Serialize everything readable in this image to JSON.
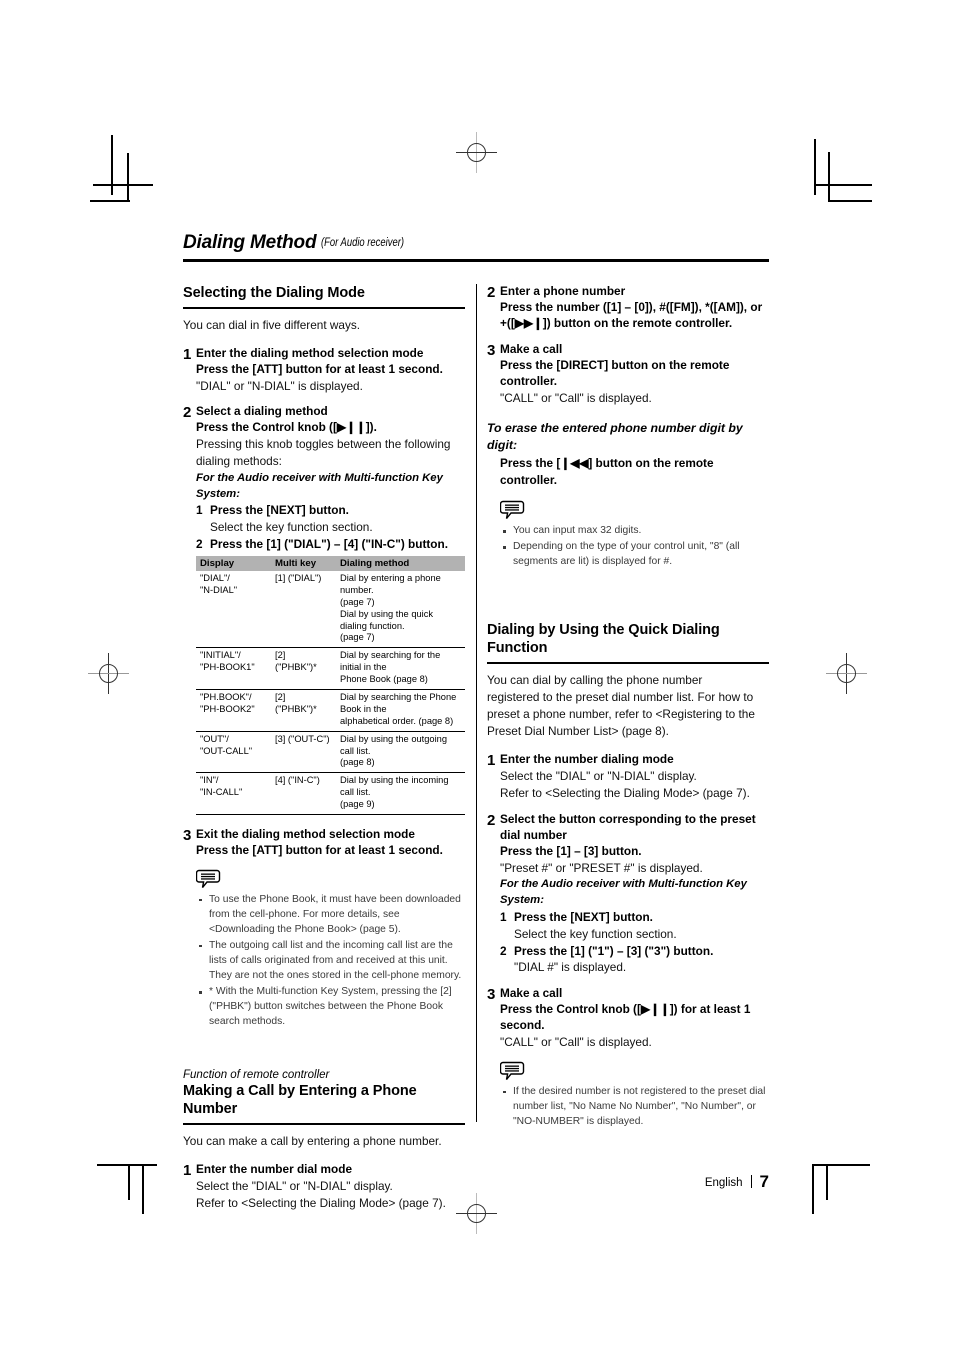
{
  "chapter": {
    "title": "Dialing Method",
    "subtitle": "(For Audio receiver)"
  },
  "left": {
    "section1": {
      "heading": "Selecting the Dialing Mode",
      "lead": "You can dial in five different ways.",
      "steps": [
        {
          "num": "1",
          "title": "Enter the dialing method selection mode",
          "bold": "Press the [ATT] button for at least 1 second.",
          "plain": "\"DIAL\" or \"N-DIAL\" is displayed."
        },
        {
          "num": "2",
          "title": "Select a dialing method",
          "bold": "Press the Control knob ([▶❙❙]).",
          "plain_1": "Pressing this knob toggles between the following",
          "plain_2": "dialing methods:",
          "italbold": "For the Audio receiver with Multi-function Key System:",
          "sub1_num": "1",
          "sub1_bold": "Press the [NEXT] button.",
          "sub1_plain": "Select the key function section.",
          "sub2_num": "2",
          "sub2_bold": "Press the [1] (\"DIAL\") – [4] (\"IN-C\") button."
        },
        {
          "num": "3",
          "title": "Exit the dialing method selection mode",
          "bold": "Press the [ATT] button for at least 1 second."
        }
      ],
      "table": {
        "headers": [
          "Display",
          "Multi key",
          "Dialing method"
        ],
        "rows": [
          {
            "display": [
              "\"DIAL\"/",
              "\"N-DIAL\""
            ],
            "multikey": [
              "[1] (\"DIAL\")"
            ],
            "method": [
              "Dial by entering a phone number.",
              "(page 7)",
              "Dial by using the quick dialing function.",
              "(page 7)"
            ]
          },
          {
            "display": [
              "\"INITIAL\"/",
              "\"PH-BOOK1\""
            ],
            "multikey": [
              "[2]",
              "(\"PHBK\")*"
            ],
            "method": [
              "Dial by searching for the initial in the",
              "Phone Book (page 8)"
            ]
          },
          {
            "display": [
              "\"PH.BOOK\"/",
              "\"PH-BOOK2\""
            ],
            "multikey": [
              "[2]",
              "(\"PHBK\")*"
            ],
            "method": [
              "Dial by searching the Phone Book in the",
              "alphabetical order. (page 8)"
            ]
          },
          {
            "display": [
              "\"OUT\"/",
              "\"OUT-CALL\""
            ],
            "multikey": [
              "[3] (\"OUT-C\")"
            ],
            "method": [
              "Dial by using the outgoing call list.",
              "(page 8)"
            ]
          },
          {
            "display": [
              "\"IN\"/",
              "\"IN-CALL\""
            ],
            "multikey": [
              "[4] (\"IN-C\")"
            ],
            "method": [
              "Dial by using the incoming call list.",
              "(page 9)"
            ]
          }
        ]
      },
      "notes": [
        {
          "text": "To use the Phone Book, it must have been downloaded from the cell-phone. For more details, see <Downloading the Phone Book> (page 5)."
        },
        {
          "text": "The outgoing call list and the incoming call list are the lists of calls originated from and received at this unit.",
          "cont": "They are not the ones stored in the cell-phone memory."
        },
        {
          "text": "* With the Multi-function Key System, pressing the [2] (\"PHBK\") button switches between the Phone Book search methods."
        }
      ]
    },
    "section2": {
      "kicker": "Function of remote controller",
      "heading": "Making a Call by Entering a Phone Number",
      "lead": "You can make a call by entering a phone number.",
      "steps": [
        {
          "num": "1",
          "title": "Enter the number dial mode",
          "plain_1": "Select the \"DIAL\" or \"N-DIAL\" display.",
          "plain_2": "Refer to <Selecting the Dialing Mode> (page 7)."
        }
      ]
    }
  },
  "right": {
    "section2_cont": {
      "steps": [
        {
          "num": "2",
          "title": "Enter a phone number",
          "bold_1": "Press the number ([1] – [0]), #([FM]), *([AM]), or",
          "bold_2": "+([▶▶❙]) button on the remote controller."
        },
        {
          "num": "3",
          "title": "Make a call",
          "bold_1": "Press the [DIRECT] button on the remote",
          "bold_2": "controller.",
          "plain": "\"CALL\" or \"Call\" is displayed."
        }
      ],
      "runin_1": "To erase the entered phone number digit by",
      "runin_2": "digit:",
      "runin_body": "Press the [❙◀◀] button on the remote controller.",
      "notes": [
        {
          "text": "You can input max 32 digits."
        },
        {
          "text": "Depending on the type of your control unit, \"8\" (all segments are lit) is displayed for #."
        }
      ]
    },
    "section3": {
      "heading_1": "Dialing by Using the Quick Dialing",
      "heading_2": "Function",
      "lead_1": "You can dial by calling the phone number",
      "lead_2": "registered to the preset dial number list. For how to",
      "lead_3": "preset a phone number, refer to <Registering to the",
      "lead_4": "Preset Dial Number List> (page 8).",
      "steps": [
        {
          "num": "1",
          "title": "Enter the number dialing mode",
          "plain_1": "Select the \"DIAL\" or \"N-DIAL\" display.",
          "plain_2": "Refer to <Selecting the Dialing Mode> (page 7)."
        },
        {
          "num": "2",
          "title_1": "Select the button corresponding to the preset",
          "title_2": "dial number",
          "bold": "Press the [1] – [3] button.",
          "plain": "\"Preset #\" or \"PRESET #\" is displayed.",
          "italbold": "For the Audio receiver with Multi-function Key System:",
          "sub1_num": "1",
          "sub1_bold": "Press the [NEXT] button.",
          "sub1_plain": "Select the key function section.",
          "sub2_num": "2",
          "sub2_bold": "Press the [1] (\"1\") – [3] (\"3\") button.",
          "sub2_plain": "\"DIAL #\" is displayed."
        },
        {
          "num": "3",
          "title": "Make a call",
          "bold_1": "Press the Control knob ([▶❙❙]) for at least 1",
          "bold_2": "second.",
          "plain": "\"CALL\" or \"Call\" is displayed."
        }
      ],
      "notes": [
        {
          "text": "If the desired number is not registered to the preset dial number list, \"No Name No Number\", \"No Number\", or \"NO-NUMBER\" is displayed."
        }
      ]
    }
  },
  "footer": {
    "language": "English",
    "page": "7"
  },
  "colors": {
    "table_header_bg": "#b2b2b2",
    "rule": "#000000",
    "note_text": "#3a3a3a"
  }
}
